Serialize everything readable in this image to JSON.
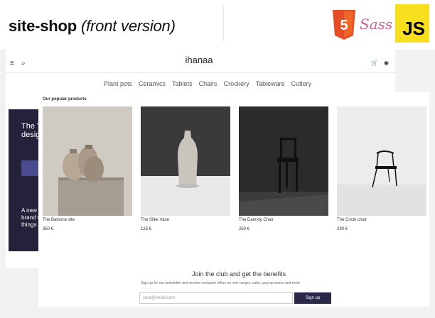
{
  "page": {
    "title": "site-shop",
    "subtitle": "(front version)"
  },
  "badges": {
    "html": "5",
    "sass": "Sass",
    "js": "JS"
  },
  "header": {
    "logo": "ihanaa",
    "menu_icon": "≡",
    "search_icon": "⌕",
    "cart_icon": "🛒",
    "account_icon": "◉"
  },
  "nav": [
    "Plant pots",
    "Ceramics",
    "Tablets",
    "Chairs",
    "Crockery",
    "Tableware",
    "Cutlery"
  ],
  "hero": {
    "line1": "The 'U",
    "line2": "desig",
    "small1": "A new",
    "small2": "brand w",
    "small3": "things c"
  },
  "popular": {
    "label": "Our popular products",
    "products": [
      {
        "name": "The Baloone site",
        "price": "350 €"
      },
      {
        "name": "The Silke Vase",
        "price": "125 €"
      },
      {
        "name": "The Danndy Chair",
        "price": "250 €"
      },
      {
        "name": "The Circle chair",
        "price": "290 €"
      }
    ]
  },
  "club": {
    "title": "Join the club and get the benefits",
    "subtitle": "Sign up for our newsletter and receive exclusive offers on new ranges, sales, pop up stores and more",
    "email_placeholder": "your@email.com",
    "signup_label": "Sign up"
  }
}
